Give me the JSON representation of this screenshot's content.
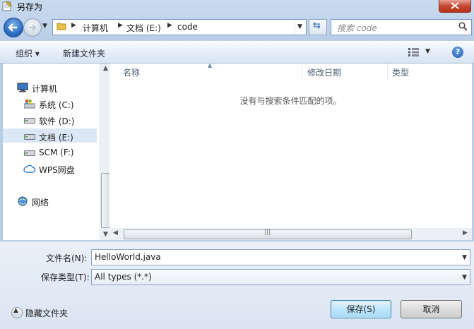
{
  "window": {
    "title": "另存为"
  },
  "nav": {
    "breadcrumbs": [
      "计算机",
      "文档 (E:)",
      "code"
    ],
    "search_placeholder": "搜索 code"
  },
  "toolbar": {
    "organize": "组织 ▾",
    "new_folder": "新建文件夹"
  },
  "tree": {
    "computer": "计算机",
    "drives": [
      {
        "label": "系统 (C:)",
        "icon": "system-drive-icon"
      },
      {
        "label": "软件 (D:)",
        "icon": "drive-icon"
      },
      {
        "label": "文档 (E:)",
        "icon": "drive-icon",
        "selected": true
      },
      {
        "label": "SCM (F:)",
        "icon": "drive-icon"
      },
      {
        "label": "WPS网盘",
        "icon": "cloud-icon"
      }
    ],
    "network": "网络"
  },
  "filelist": {
    "columns": [
      "名称",
      "修改日期",
      "类型"
    ],
    "empty_message": "没有与搜索条件匹配的项。"
  },
  "form": {
    "filename_label": "文件名(N):",
    "filename_value": "HelloWorld.java",
    "type_label": "保存类型(T):",
    "type_value": "All types (*.*)",
    "hide_folders": "隐藏文件夹",
    "save": "保存(S)",
    "cancel": "取消"
  },
  "colors": {
    "accent": "#2c6cc2",
    "selection": "#dce7f5",
    "primary_button": "#bee6fd"
  }
}
